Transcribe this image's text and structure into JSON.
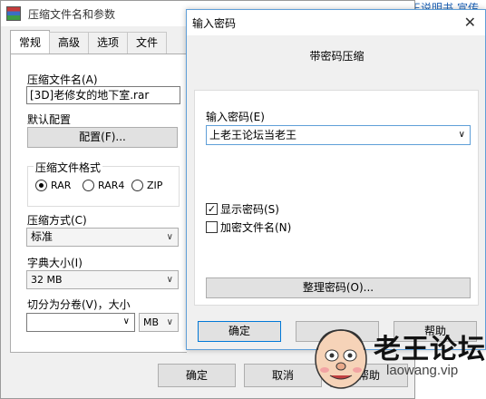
{
  "background": {
    "link_help": "王说明书",
    "link_more": "宣传"
  },
  "main_dialog": {
    "title": "压缩文件名和参数",
    "tabs": [
      "常规",
      "高级",
      "选项",
      "文件"
    ],
    "archive_name_label": "压缩文件名(A)",
    "archive_name_value": "[3D]老修女的地下室.rar",
    "default_profile_label": "默认配置",
    "profiles_button": "配置(F)...",
    "format_group_label": "压缩文件格式",
    "formats": [
      {
        "label": "RAR",
        "selected": true
      },
      {
        "label": "RAR4",
        "selected": false
      },
      {
        "label": "ZIP",
        "selected": false
      }
    ],
    "method_label": "压缩方式(C)",
    "method_value": "标准",
    "dict_label": "字典大小(I)",
    "dict_value": "32 MB",
    "split_label": "切分为分卷(V)，大小",
    "split_value": "",
    "split_unit": "MB",
    "ok_button": "确定",
    "cancel_button": "取消",
    "help_button": "帮助"
  },
  "password_dialog": {
    "title": "输入密码",
    "heading": "带密码压缩",
    "enter_password_label": "输入密码(E)",
    "password_value": "上老王论坛当老王",
    "show_password_label": "显示密码(S)",
    "show_password_checked": true,
    "encrypt_names_label": "加密文件名(N)",
    "encrypt_names_checked": false,
    "organize_button": "整理密码(O)...",
    "ok_button": "确定",
    "help_button": "帮助"
  },
  "watermark": {
    "brand": "老王论坛",
    "url": "laowang.vip"
  }
}
